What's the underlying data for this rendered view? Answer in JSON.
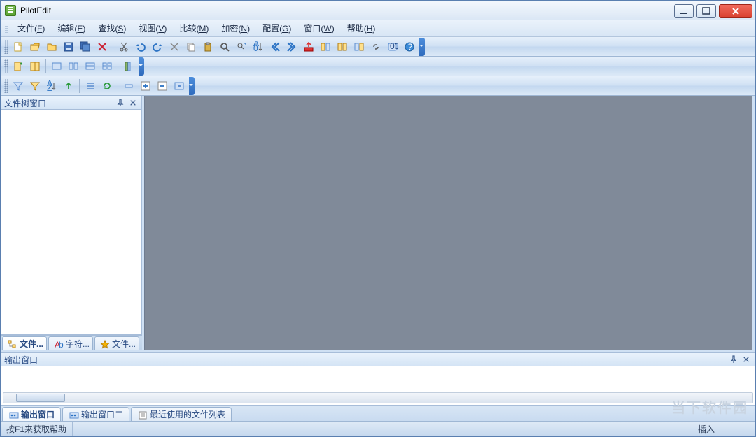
{
  "app": {
    "title": "PilotEdit"
  },
  "menus": [
    {
      "label": "文件",
      "accel": "F"
    },
    {
      "label": "编辑",
      "accel": "E"
    },
    {
      "label": "查找",
      "accel": "S"
    },
    {
      "label": "视图",
      "accel": "V"
    },
    {
      "label": "比较",
      "accel": "M"
    },
    {
      "label": "加密",
      "accel": "N"
    },
    {
      "label": "配置",
      "accel": "G"
    },
    {
      "label": "窗口",
      "accel": "W"
    },
    {
      "label": "帮助",
      "accel": "H"
    }
  ],
  "toolbar1": [
    {
      "name": "new-file-icon"
    },
    {
      "name": "open-file-icon"
    },
    {
      "name": "open-folder-icon"
    },
    {
      "name": "save-icon"
    },
    {
      "name": "save-all-icon"
    },
    {
      "name": "close-icon"
    },
    {
      "sep": true
    },
    {
      "name": "cut-icon"
    },
    {
      "name": "undo-icon"
    },
    {
      "name": "redo-icon"
    },
    {
      "name": "cut2-icon"
    },
    {
      "name": "copy-icon"
    },
    {
      "name": "paste-icon"
    },
    {
      "name": "find-icon"
    },
    {
      "name": "find-replace-icon"
    },
    {
      "name": "sort-icon"
    },
    {
      "name": "nav-prev-icon"
    },
    {
      "name": "nav-next-icon"
    },
    {
      "name": "upload-icon"
    },
    {
      "name": "compare-left-icon"
    },
    {
      "name": "compare-both-icon"
    },
    {
      "name": "compare-right-icon"
    },
    {
      "name": "link-icon"
    },
    {
      "name": "hex-icon"
    },
    {
      "name": "help-icon"
    }
  ],
  "toolbar2": [
    {
      "name": "bookmark-add-icon"
    },
    {
      "name": "bookmark-list-icon"
    },
    {
      "sep": true
    },
    {
      "name": "screen1-icon"
    },
    {
      "name": "screen2-icon"
    },
    {
      "name": "screen-split-icon"
    },
    {
      "name": "screen-grid-icon"
    },
    {
      "sep": true
    },
    {
      "name": "column-icon"
    }
  ],
  "toolbar3": [
    {
      "name": "filter-icon"
    },
    {
      "name": "filter2-icon"
    },
    {
      "name": "sort-az-icon"
    },
    {
      "name": "up-arrow-icon"
    },
    {
      "sep": true
    },
    {
      "name": "list-icon"
    },
    {
      "name": "refresh-icon"
    },
    {
      "sep": true
    },
    {
      "name": "collapse-icon"
    },
    {
      "name": "plus-icon"
    },
    {
      "name": "minus-icon"
    },
    {
      "name": "options-icon"
    }
  ],
  "left_panel": {
    "title": "文件树窗口",
    "tabs": [
      {
        "label": "文件...",
        "icon": "tree-icon",
        "active": true
      },
      {
        "label": "字符...",
        "icon": "chars-icon",
        "active": false
      },
      {
        "label": "文件...",
        "icon": "star-icon",
        "active": false
      }
    ]
  },
  "output_panel": {
    "title": "输出窗口",
    "tabs": [
      {
        "label": "输出窗口",
        "icon": "output-icon",
        "active": true
      },
      {
        "label": "输出窗口二",
        "icon": "output-icon",
        "active": false
      },
      {
        "label": "最近使用的文件列表",
        "icon": "recent-icon",
        "active": false
      }
    ]
  },
  "status": {
    "help": "按F1来获取帮助",
    "mode": "插入"
  },
  "watermark": "当下软件园"
}
